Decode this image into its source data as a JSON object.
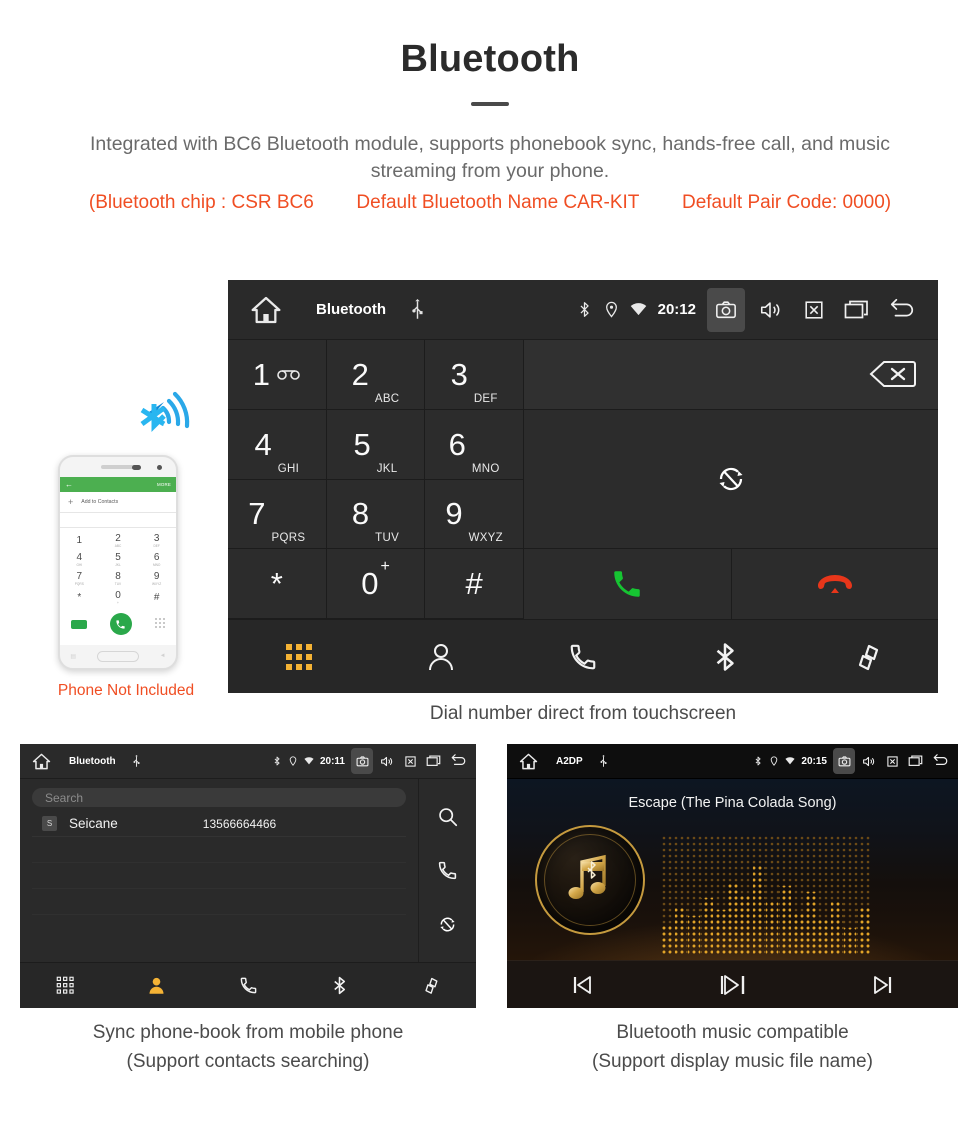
{
  "header": {
    "title": "Bluetooth",
    "intro": "Integrated with BC6 Bluetooth module, supports phonebook sync, hands-free call, and music streaming from your phone.",
    "spec_open": "(Bluetooth chip : CSR BC6",
    "spec_name": "Default Bluetooth Name CAR-KIT",
    "spec_code": "Default Pair Code: 0000)",
    "accent_color": "#f04e23",
    "body_color": "#6a6a6a"
  },
  "dialer": {
    "statusbar": {
      "app_title": "Bluetooth",
      "clock": "20:12",
      "icons": [
        "home-icon",
        "usb-icon",
        "bluetooth-icon",
        "location-icon",
        "wifi-icon",
        "camera-icon",
        "volume-icon",
        "close-icon",
        "recents-icon",
        "back-icon"
      ]
    },
    "keys": [
      {
        "digit": "1",
        "letters": "",
        "sub": "voicemail"
      },
      {
        "digit": "2",
        "letters": "ABC",
        "sub": ""
      },
      {
        "digit": "3",
        "letters": "DEF",
        "sub": ""
      },
      {
        "digit": "4",
        "letters": "GHI",
        "sub": ""
      },
      {
        "digit": "5",
        "letters": "JKL",
        "sub": ""
      },
      {
        "digit": "6",
        "letters": "MNO",
        "sub": ""
      },
      {
        "digit": "7",
        "letters": "PQRS",
        "sub": ""
      },
      {
        "digit": "8",
        "letters": "TUV",
        "sub": ""
      },
      {
        "digit": "9",
        "letters": "WXYZ",
        "sub": ""
      },
      {
        "digit": "*",
        "letters": "",
        "sub": ""
      },
      {
        "digit": "0",
        "letters": "",
        "sub": "+"
      },
      {
        "digit": "#",
        "letters": "",
        "sub": ""
      }
    ],
    "actions": {
      "backspace": "backspace-icon",
      "sync": "sync-icon",
      "call": "call-icon",
      "hangup": "hangup-icon",
      "call_color": "#16c432",
      "hangup_color": "#e8361a"
    },
    "tabs": [
      {
        "name": "keypad",
        "icon": "keypad-icon",
        "active": true
      },
      {
        "name": "contacts",
        "icon": "contact-icon",
        "active": false
      },
      {
        "name": "call-log",
        "icon": "phone-icon",
        "active": false
      },
      {
        "name": "bluetooth",
        "icon": "bluetooth-icon",
        "active": false
      },
      {
        "name": "pair",
        "icon": "link-icon",
        "active": false
      }
    ],
    "active_color": "#f5b335",
    "caption": "Dial number direct from touchscreen"
  },
  "phone_mock": {
    "bt_icon": "bluetooth-signal-icon",
    "bt_color": "#1aa3e8",
    "app_bar_color": "#4caf50",
    "back_glyph": "←",
    "more_label": "MORE",
    "add_label": "Add to Contacts",
    "keys": [
      {
        "n": "1",
        "s": ""
      },
      {
        "n": "2",
        "s": "ABC"
      },
      {
        "n": "3",
        "s": "DEF"
      },
      {
        "n": "4",
        "s": "GHI"
      },
      {
        "n": "5",
        "s": "JKL"
      },
      {
        "n": "6",
        "s": "MNO"
      },
      {
        "n": "7",
        "s": "PQRS"
      },
      {
        "n": "8",
        "s": "TUV"
      },
      {
        "n": "9",
        "s": "WXYZ"
      },
      {
        "n": "*",
        "s": ""
      },
      {
        "n": "0",
        "s": "+"
      },
      {
        "n": "#",
        "s": ""
      }
    ],
    "caption": "Phone Not Included",
    "caption_color": "#f04e23"
  },
  "contacts_panel": {
    "statusbar": {
      "app_title": "Bluetooth",
      "clock": "20:11"
    },
    "search_placeholder": "Search",
    "columns": [
      "name",
      "number"
    ],
    "rows": [
      {
        "initial": "S",
        "name": "Seicane",
        "number": "13566664466"
      }
    ],
    "side_actions": [
      "search-icon",
      "phone-icon",
      "sync-icon"
    ],
    "tabs": [
      {
        "name": "keypad",
        "active": false
      },
      {
        "name": "contacts",
        "active": true
      },
      {
        "name": "call-log",
        "active": false
      },
      {
        "name": "bluetooth",
        "active": false
      },
      {
        "name": "pair",
        "active": false
      }
    ],
    "caption_line1": "Sync phone-book from mobile phone",
    "caption_line2": "(Support contacts searching)"
  },
  "music_panel": {
    "statusbar": {
      "app_title": "A2DP",
      "clock": "20:15"
    },
    "song_title": "Escape (The Pina Colada Song)",
    "album_icon": "music-note-bluetooth-icon",
    "accent_color": "#d6a33f",
    "controls": [
      {
        "name": "previous",
        "icon": "skip-previous-icon"
      },
      {
        "name": "play-pause",
        "icon": "play-pause-icon"
      },
      {
        "name": "next",
        "icon": "skip-next-icon"
      }
    ],
    "caption_line1": "Bluetooth music compatible",
    "caption_line2": "(Support display music file name)"
  }
}
